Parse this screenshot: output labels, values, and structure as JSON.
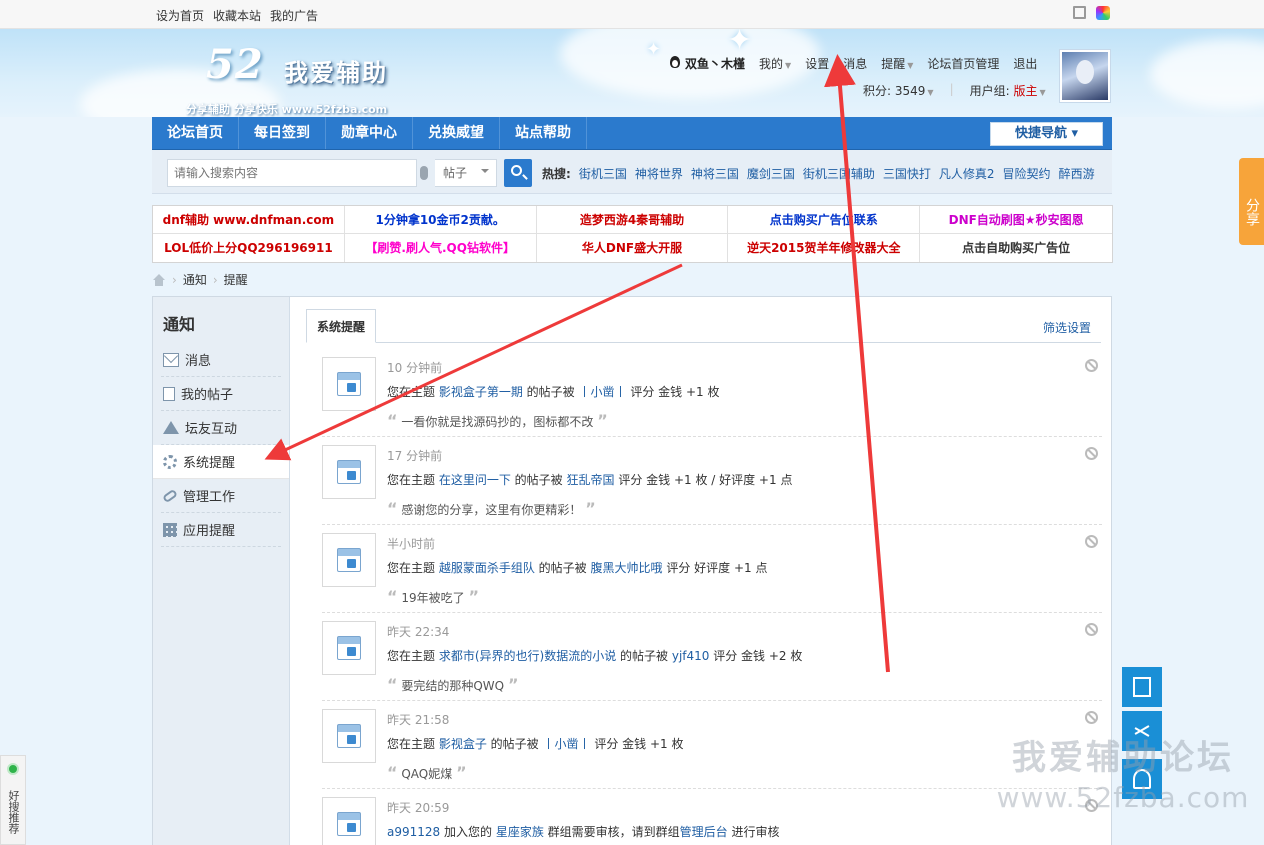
{
  "topbar": {
    "links": [
      "设为首页",
      "收藏本站",
      "我的广告"
    ],
    "tools": [
      "fullscreen-icon",
      "color-palette-icon"
    ]
  },
  "header": {
    "logo_number": "52",
    "logo_name": "我爱辅助",
    "logo_slogan": "分享辅助  分享快乐  www.52fzba.com",
    "username": "双鱼丶木槿",
    "nav": [
      "我的",
      "设置",
      "消息",
      "提醒",
      "论坛首页管理",
      "退出"
    ],
    "points_label": "积分: 3549",
    "group_label": "用户组:",
    "group_value": "版主"
  },
  "mainnav": {
    "items": [
      "论坛首页",
      "每日签到",
      "勋章中心",
      "兑换威望",
      "站点帮助"
    ],
    "quick_nav": "快捷导航 ▾"
  },
  "search": {
    "placeholder": "请输入搜索内容",
    "type": "帖子",
    "hot_label": "热搜:",
    "hot_items": [
      "街机三国",
      "神将世界",
      "神将三国",
      "魔剑三国",
      "街机三国辅助",
      "三国快打",
      "凡人修真2",
      "冒险契约",
      "醉西游"
    ]
  },
  "ads": [
    {
      "text": "dnf辅助 www.dnfman.com",
      "color": "#cc0000"
    },
    {
      "text": "1分钟拿10金币2贡献。",
      "color": "#0033cc"
    },
    {
      "text": "造梦西游4秦哥辅助",
      "color": "#cc0000"
    },
    {
      "text": "点击购买广告位联系",
      "color": "#0033cc"
    },
    {
      "text": "DNF自动刷图★秒安图恩",
      "color": "#cc00cc"
    },
    {
      "text": "LOL低价上分QQ296196911",
      "color": "#cc0000"
    },
    {
      "text": "【刷赞.刷人气.QQ钻软件】",
      "color": "#ff00cc"
    },
    {
      "text": "华人DNF盛大开服",
      "color": "#cc0000"
    },
    {
      "text": "逆天2015贺羊年修改器大全",
      "color": "#cc0000"
    },
    {
      "text": "点击自助购买广告位",
      "color": "#333333"
    }
  ],
  "breadcrumb": [
    "通知",
    "提醒"
  ],
  "sidebar": {
    "title": "通知",
    "items": [
      {
        "label": "消息",
        "icon": "envelope-icon"
      },
      {
        "label": "我的帖子",
        "icon": "document-icon"
      },
      {
        "label": "坛友互动",
        "icon": "recycle-icon"
      },
      {
        "label": "系统提醒",
        "icon": "gear-icon"
      },
      {
        "label": "管理工作",
        "icon": "link-icon"
      },
      {
        "label": "应用提醒",
        "icon": "grid-icon"
      }
    ]
  },
  "tabs": {
    "active": "系统提醒",
    "filter": "筛选设置"
  },
  "notices": [
    {
      "time": "10 分钟前",
      "parts": [
        [
          "您在主题 ",
          0
        ],
        [
          "影视盒子第一期",
          1
        ],
        [
          " 的帖子被 ",
          0
        ],
        [
          "丨小凿丨",
          1
        ],
        [
          " 评分 金钱 +1 枚",
          0
        ]
      ],
      "quote": "一看你就是找源码抄的，图标都不改"
    },
    {
      "time": "17 分钟前",
      "parts": [
        [
          "您在主题 ",
          0
        ],
        [
          "在这里问一下",
          1
        ],
        [
          " 的帖子被 ",
          0
        ],
        [
          "狂乱帝国",
          1
        ],
        [
          " 评分 金钱 +1 枚 / 好评度 +1 点",
          0
        ]
      ],
      "quote": "感谢您的分享，这里有你更精彩！"
    },
    {
      "time": "半小时前",
      "parts": [
        [
          "您在主题 ",
          0
        ],
        [
          "越服蒙面杀手组队",
          1
        ],
        [
          " 的帖子被 ",
          0
        ],
        [
          "腹黑大帅比哦",
          1
        ],
        [
          " 评分 好评度 +1 点",
          0
        ]
      ],
      "quote": "19年被吃了"
    },
    {
      "time": "昨天 22:34",
      "parts": [
        [
          "您在主题 ",
          0
        ],
        [
          "求都市(异界的也行)数据流的小说",
          1
        ],
        [
          " 的帖子被 ",
          0
        ],
        [
          "yjf410",
          1
        ],
        [
          " 评分 金钱 +2 枚",
          0
        ]
      ],
      "quote": "要完结的那种QWQ"
    },
    {
      "time": "昨天 21:58",
      "parts": [
        [
          "您在主题 ",
          0
        ],
        [
          "影视盒子",
          1
        ],
        [
          " 的帖子被 ",
          0
        ],
        [
          "丨小凿丨",
          1
        ],
        [
          " 评分 金钱 +1 枚",
          0
        ]
      ],
      "quote": "QAQ妮煤"
    },
    {
      "time": "昨天 20:59",
      "parts": [
        [
          "a991128",
          1
        ],
        [
          " 加入您的 ",
          0
        ],
        [
          "星座家族",
          1
        ],
        [
          " 群组需要审核，请到群组",
          0
        ],
        [
          "管理后台",
          1
        ],
        [
          " 进行审核",
          0
        ]
      ],
      "quote": ""
    }
  ],
  "side_widgets": {
    "share_tab": "分享",
    "float_buttons": [
      "document-edit-icon",
      "share-icon",
      "person-icon"
    ],
    "watermark_line1": "我爱辅助论坛",
    "watermark_line2": "www.52fzba.com",
    "haosou": "好搜推荐"
  },
  "colors": {
    "accent": "#2b7acd",
    "link": "#1f5ea3",
    "annotation_arrow": "#ee3a3a"
  }
}
